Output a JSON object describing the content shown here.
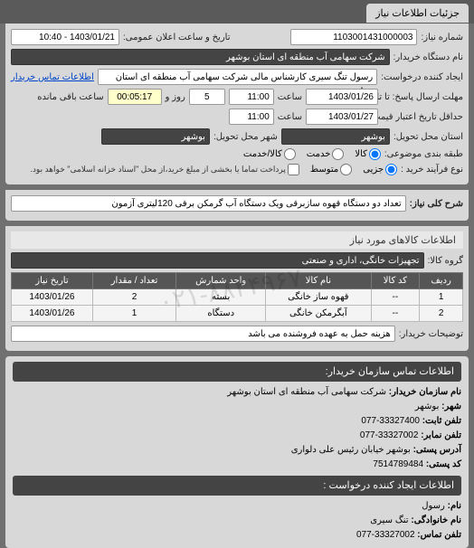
{
  "tab": {
    "title": "جزئیات اطلاعات نیاز"
  },
  "fields": {
    "needNo_lbl": "شماره نیاز:",
    "needNo": "1103001431000003",
    "publicDate_lbl": "تاریخ و ساعت اعلان عمومی:",
    "publicDate": "1403/01/21 - 10:40",
    "buyerOrg_lbl": "نام دستگاه خریدار:",
    "buyerOrg": "شرکت سهامی آب منطقه ای استان بوشهر",
    "requester_lbl": "ایجاد کننده درخواست:",
    "requester": "رسول تنگ سیری کارشناس مالی شرکت سهامی آب منطقه ای استان بوشهر",
    "contactLink": "اطلاعات تماس خریدار",
    "deadline_lbl": "مهلت ارسال پاسخ: تا تاریخ:",
    "deadlineDate": "1403/01/26",
    "deadlineTime_lbl": "ساعت",
    "deadlineTime": "11:00",
    "days_lbl": "روز و",
    "days": "5",
    "remain_lbl": "ساعت باقی مانده",
    "remain": "00:05:17",
    "validity_lbl": "حداقل تاریخ اعتبار قیمت: تا تاریخ:",
    "validityDate": "1403/01/27",
    "validityTime": "11:00",
    "deliverState_lbl": "استان محل تحویل:",
    "deliverState": "بوشهر",
    "deliverCity_lbl": "شهر محل تحویل:",
    "deliverCity": "بوشهر",
    "budget_lbl": "طبقه بندی موضوعی:",
    "budget_kala": "کالا",
    "budget_service": "خدمت",
    "budget_kalaService": "کالا/خدمت",
    "buyType_lbl": "نوع فرآیند خرید :",
    "buy_partial": "جزیی",
    "buy_medium": "متوسط",
    "buy_note": "پرداخت تماما یا بخشی از مبلغ خرید،از محل \"اسناد خزانه اسلامی\" خواهد بود.",
    "needSummary_lbl": "شرح کلی نیاز:",
    "needSummary": "تعداد دو دستگاه قهوه سازبرقی ویک دستگاه آب گرمکن برقی 120لیتری آزمون"
  },
  "sections": {
    "goodsHdr": "اطلاعات کالاهای مورد نیاز",
    "group_lbl": "گروه کالا:",
    "group": "تجهیزات خانگی، اداری و صنعتی",
    "buyerDesc_lbl": "توضیحات خریدار:",
    "buyerDesc": "هزینه حمل به عهده فروشنده می باشد",
    "contactHdr": "اطلاعات تماس سازمان خریدار:"
  },
  "table": {
    "headers": [
      "ردیف",
      "کد کالا",
      "نام کالا",
      "واحد شمارش",
      "تعداد / مقدار",
      "تاریخ نیاز"
    ],
    "rows": [
      [
        "1",
        "--",
        "قهوه ساز خانگی",
        "بسته",
        "2",
        "1403/01/26"
      ],
      [
        "2",
        "--",
        "آبگرمکن خانگی",
        "دستگاه",
        "1",
        "1403/01/26"
      ]
    ]
  },
  "contact": {
    "orgName_lbl": "نام سازمان خریدار:",
    "orgName": "شرکت سهامی آب منطقه ای استان بوشهر",
    "city_lbl": "شهر:",
    "city": "بوشهر",
    "phone_lbl": "تلفن ثابت:",
    "phone": "33327400-077",
    "fax_lbl": "تلفن نمابر:",
    "fax": "33327002-077",
    "address_lbl": "آدرس پستی:",
    "address": "بوشهر خیابان رئیس علی دلواری",
    "postal_lbl": "کد پستی:",
    "postal": "7514789484",
    "creatorHdr": "اطلاعات ایجاد کننده درخواست :",
    "fname_lbl": "نام:",
    "fname": "رسول",
    "lname_lbl": "نام خانوادگی:",
    "lname": "تنگ سیری",
    "cphone_lbl": "تلفن تماس:",
    "cphone": "33327002-077"
  },
  "watermark": "۰۲۱-۸۸۳۴۹۶۷۰"
}
